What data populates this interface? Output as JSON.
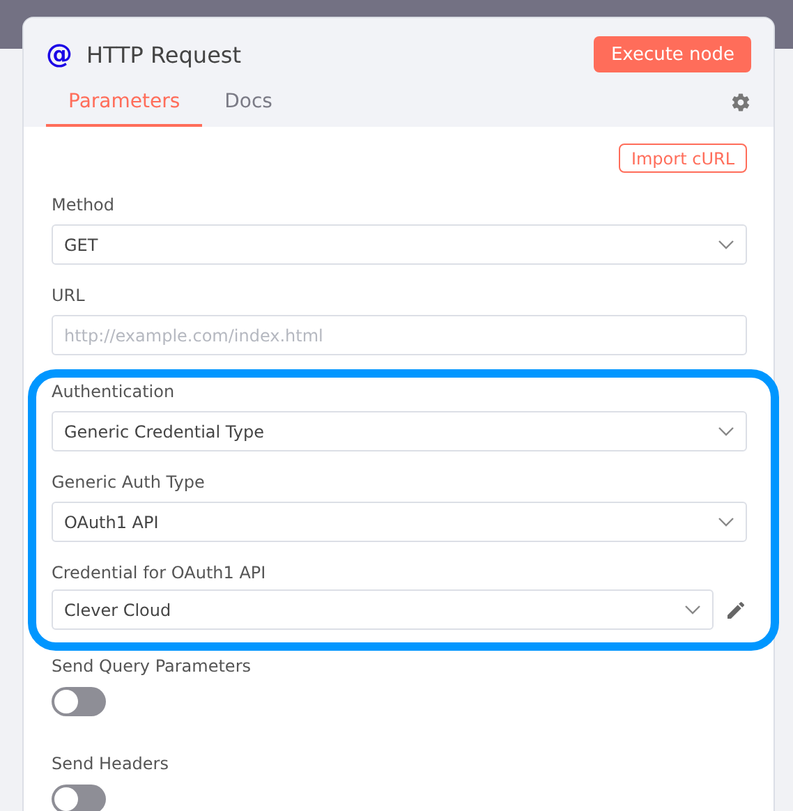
{
  "node": {
    "icon": "@",
    "title": "HTTP Request",
    "execute_button": "Execute node"
  },
  "tabs": [
    {
      "label": "Parameters",
      "selected": true
    },
    {
      "label": "Docs",
      "selected": false
    }
  ],
  "import_button": "Import cURL",
  "parameters": [
    {
      "kind": "select",
      "label": "Method",
      "value": "GET"
    },
    {
      "kind": "input",
      "label": "URL",
      "placeholder": "http://example.com/index.html"
    }
  ],
  "highlighted_parameters": [
    {
      "kind": "select",
      "label": "Authentication",
      "value": "Generic Credential Type"
    },
    {
      "kind": "select",
      "label": "Generic Auth Type",
      "value": "OAuth1 API"
    },
    {
      "kind": "credential",
      "label": "Credential for OAuth1 API",
      "value": "Clever Cloud"
    }
  ],
  "options": [
    {
      "kind": "toggle",
      "label": "Send Query Parameters",
      "on": false
    },
    {
      "kind": "toggle",
      "label": "Send Headers",
      "on": false
    }
  ]
}
